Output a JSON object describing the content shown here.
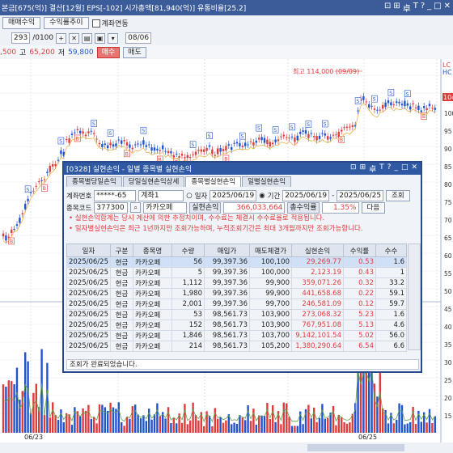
{
  "topbar": {
    "info": "본금[675(억)] 결산[12월] EPS[-102] 시가총액[81,940(억)] 유통비율[25.2]",
    "icons": [
      "link-icon",
      "settings-icon",
      "restore-icon",
      "help-icon",
      "minimize-icon",
      "maximize-icon",
      "close-icon"
    ],
    "icon_glyphs": [
      "⊡",
      "⊞",
      "卓",
      "T",
      "?",
      "_",
      "□",
      "✕"
    ]
  },
  "toolbar": {
    "btn1": "매매수익",
    "btn2": "수익률추이",
    "checkbox_label": "계좌연동",
    "field_value": "293",
    "field_suffix": "/0100",
    "date_value": "08/06"
  },
  "price": {
    "prev": ",500",
    "high_label": "고",
    "high": "65,200",
    "low_label": "저",
    "low": "59,800",
    "buy": "매수",
    "sell": "매도"
  },
  "chart": {
    "annotation": "최고 114,000 (09/09)",
    "x_labels": [
      "06/23",
      "06/25"
    ],
    "y_labels": [
      "105",
      "100",
      "95",
      "90",
      "85",
      "80",
      "75",
      "70",
      "65",
      "60",
      "55",
      "50",
      "45",
      "40",
      "35",
      "30",
      "25",
      "20",
      "15",
      "10"
    ],
    "right_labels": [
      "LC",
      "HC"
    ],
    "last_price": "104"
  },
  "dialog": {
    "title": "[0328] 실현손익 - 일별 종목별 실현손익",
    "title_icons": [
      "link-icon",
      "settings-icon",
      "restore-icon",
      "help-icon",
      "minimize-icon",
      "maximize-icon",
      "close-icon"
    ],
    "tabs": [
      "종목별당일손익",
      "당일실현손익상세",
      "종목별실현손익",
      "일별실현손익"
    ],
    "account_label": "계좌번호",
    "account_value": "*****-65",
    "account_name": "계좌1",
    "radio_day": "일자",
    "radio_period": "기간",
    "date1": "2025/06/19",
    "date2": "2025/06/19",
    "date3": "2025/06/25",
    "query_button": "조회",
    "code_label": "종목코드",
    "code_value": "377300",
    "stock_name": "카카오페",
    "realized_label": "실현손익",
    "realized_value": "366,033,664",
    "total_rate_label": "총수익률",
    "total_rate_value": "1.35%",
    "next_button": "다음",
    "notice1": "• 실현손익합계는 당시 계산에 의한 추정치이며, 수수료는 체결시 수수료율로 적용됩니다.",
    "notice2": "• 일자별실현손익은 최근 1년까지만 조회가능하며, 누적조회기간은 최대 3개월까지만 조회가능합니다.",
    "columns": [
      "일자",
      "구분",
      "종목명",
      "수량",
      "매입가",
      "매도체결가",
      "실현손익",
      "수익률",
      "수수"
    ],
    "rows": [
      [
        "2025/06/25",
        "현금",
        "카카오페",
        "56",
        "99,397.36",
        "100,100",
        "29,269.77",
        "0.53",
        "1.6"
      ],
      [
        "2025/06/25",
        "현금",
        "카카오페",
        "5",
        "99,397.36",
        "100,000",
        "2,123.19",
        "0.43",
        "1"
      ],
      [
        "2025/06/25",
        "현금",
        "카카오페",
        "1,112",
        "99,397.36",
        "99,900",
        "359,071.26",
        "0.32",
        "33.2"
      ],
      [
        "2025/06/25",
        "현금",
        "카카오페",
        "1,980",
        "99,397.36",
        "99,900",
        "441,658.68",
        "0.22",
        "59.1"
      ],
      [
        "2025/06/25",
        "현금",
        "카카오페",
        "2,001",
        "99,397.36",
        "99,700",
        "246,581.09",
        "0.12",
        "59.7"
      ],
      [
        "2025/06/25",
        "현금",
        "카카오페",
        "53",
        "98,561.73",
        "103,900",
        "273,068.32",
        "5.23",
        "1.6"
      ],
      [
        "2025/06/25",
        "현금",
        "카카오페",
        "152",
        "98,561.73",
        "103,900",
        "767,951.08",
        "5.13",
        "4.6"
      ],
      [
        "2025/06/25",
        "현금",
        "카카오페",
        "1,846",
        "98,561.73",
        "103,700",
        "9,142,101.54",
        "5.02",
        "56.0"
      ],
      [
        "2025/06/25",
        "현금",
        "카카오페",
        "214",
        "98,561.73",
        "105,200",
        "1,380,290.64",
        "6.54",
        "6.6"
      ]
    ],
    "status": "조회가 완료되었습니다."
  }
}
